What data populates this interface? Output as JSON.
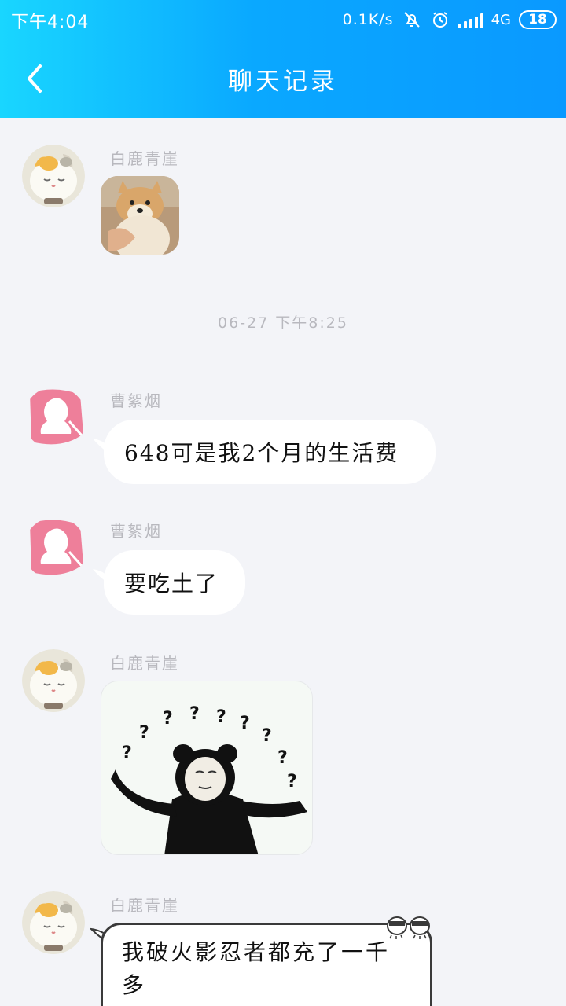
{
  "status_bar": {
    "time": "下午4:04",
    "net_speed": "0.1K/s",
    "network": "4G",
    "battery": "18"
  },
  "header": {
    "title": "聊天记录"
  },
  "messages": [
    {
      "sender": "白鹿青崖",
      "type": "sticker",
      "sticker": "shiba-dog-sticker"
    },
    {
      "separator": "06-27 下午8:25"
    },
    {
      "sender": "曹絮烟",
      "type": "text",
      "text": "648可是我2个月的生活费"
    },
    {
      "sender": "曹絮烟",
      "type": "text",
      "text": "要吃土了"
    },
    {
      "sender": "白鹿青崖",
      "type": "sticker",
      "sticker": "panda-question-marks-sticker"
    },
    {
      "sender": "白鹿青崖",
      "type": "text",
      "text": "我破火影忍者都充了一千多"
    }
  ],
  "colors": {
    "header_start": "#19d6ff",
    "header_end": "#0a99ff",
    "background": "#f3f4f8",
    "bubble": "#ffffff",
    "sender_text": "#b8b8be"
  }
}
